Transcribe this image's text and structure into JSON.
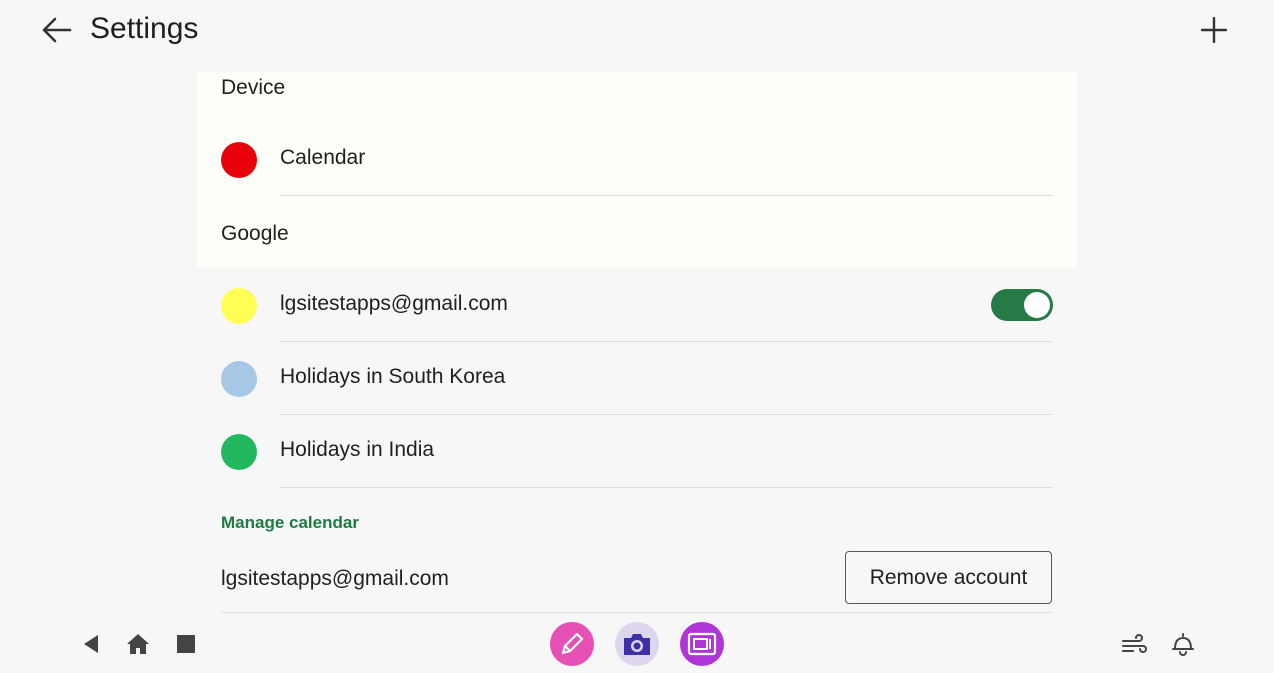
{
  "appbar": {
    "title": "Settings",
    "back_icon": "arrow-left-icon",
    "add_icon": "plus-icon"
  },
  "sections": {
    "device_header": "Device",
    "google_header": "Google"
  },
  "calendars": {
    "device": [
      {
        "label": "Calendar",
        "color": "#e8000b"
      }
    ],
    "google": [
      {
        "label": "lgsitestapps@gmail.com",
        "color": "#ffff55",
        "toggle_on": true
      },
      {
        "label": "Holidays in South Korea",
        "color": "#a6c8e4"
      },
      {
        "label": "Holidays in India",
        "color": "#22b95e"
      }
    ]
  },
  "manage": {
    "title": "Manage calendar",
    "account_email": "lgsitestapps@gmail.com",
    "remove_label": "Remove account"
  },
  "colors": {
    "accent": "#1e7a45",
    "toggle_track": "#257a45",
    "section_bg": "#fbfff7"
  },
  "navbar": {
    "left": [
      "back-triangle-icon",
      "home-icon",
      "recents-square-icon"
    ],
    "apps": [
      {
        "name": "pen-app-icon",
        "color": "#e64fb3"
      },
      {
        "name": "camera-app-icon",
        "color": "#ded6ef"
      },
      {
        "name": "screen-capture-app-icon",
        "color": "#b035d8"
      }
    ],
    "right": [
      "wind-icon",
      "notification-bell-icon"
    ]
  }
}
